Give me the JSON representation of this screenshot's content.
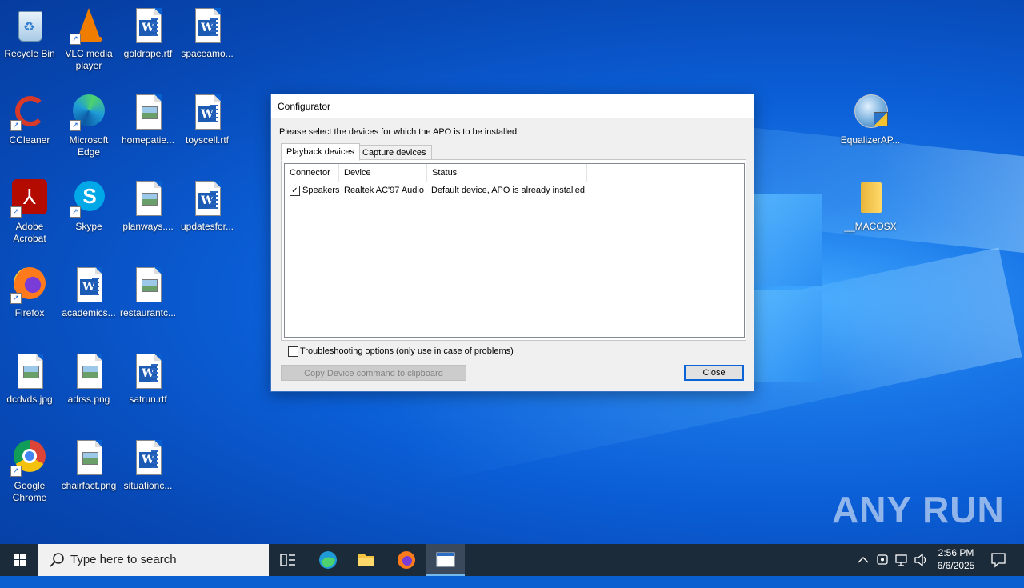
{
  "desktop": {
    "icons": [
      {
        "label": "Recycle Bin",
        "icon": "recycle-bin-icon"
      },
      {
        "label": "VLC media player",
        "icon": "vlc-icon"
      },
      {
        "label": "goldrape.rtf",
        "icon": "word-document-icon"
      },
      {
        "label": "spaceamo...",
        "icon": "word-document-icon"
      },
      {
        "label": "CCleaner",
        "icon": "ccleaner-icon"
      },
      {
        "label": "Microsoft Edge",
        "icon": "edge-icon"
      },
      {
        "label": "homepatie...",
        "icon": "image-file-icon"
      },
      {
        "label": "toyscell.rtf",
        "icon": "word-document-icon"
      },
      {
        "label": "Adobe Acrobat",
        "icon": "acrobat-icon"
      },
      {
        "label": "Skype",
        "icon": "skype-icon"
      },
      {
        "label": "planways....",
        "icon": "image-file-icon"
      },
      {
        "label": "updatesfor...",
        "icon": "word-document-icon"
      },
      {
        "label": "Firefox",
        "icon": "firefox-icon"
      },
      {
        "label": "academics...",
        "icon": "word-document-icon"
      },
      {
        "label": "restaurantc...",
        "icon": "image-file-icon"
      },
      {
        "label": "dcdvds.jpg",
        "icon": "image-file-icon"
      },
      {
        "label": "adrss.png",
        "icon": "image-file-icon"
      },
      {
        "label": "satrun.rtf",
        "icon": "word-document-icon"
      },
      {
        "label": "Google Chrome",
        "icon": "chrome-icon"
      },
      {
        "label": "chairfact.png",
        "icon": "image-file-icon"
      },
      {
        "label": "situationc...",
        "icon": "word-document-icon"
      },
      {
        "label": "EqualizerAP...",
        "icon": "installer-icon"
      },
      {
        "label": "__MACOSX",
        "icon": "folder-icon"
      }
    ],
    "watermark": "ANY RUN"
  },
  "dialog": {
    "title": "Configurator",
    "prompt": "Please select the devices for which the APO is to be installed:",
    "tabs": [
      "Playback devices",
      "Capture devices"
    ],
    "columns": [
      "Connector",
      "Device",
      "Status"
    ],
    "rows": [
      {
        "checked": true,
        "connector": "Speakers",
        "device": "Realtek AC'97 Audio",
        "status": "Default device, APO is already installed"
      }
    ],
    "troubleshooting_label": "Troubleshooting options (only use in case of problems)",
    "troubleshooting_checked": false,
    "copy_button": "Copy Device command to clipboard",
    "close_button": "Close"
  },
  "taskbar": {
    "search_placeholder": "Type here to search",
    "time": "2:56 PM",
    "date": "6/6/2025",
    "apps": [
      "task-view-icon",
      "edge-icon",
      "file-explorer-icon",
      "firefox-icon",
      "configurator-window-icon"
    ]
  }
}
